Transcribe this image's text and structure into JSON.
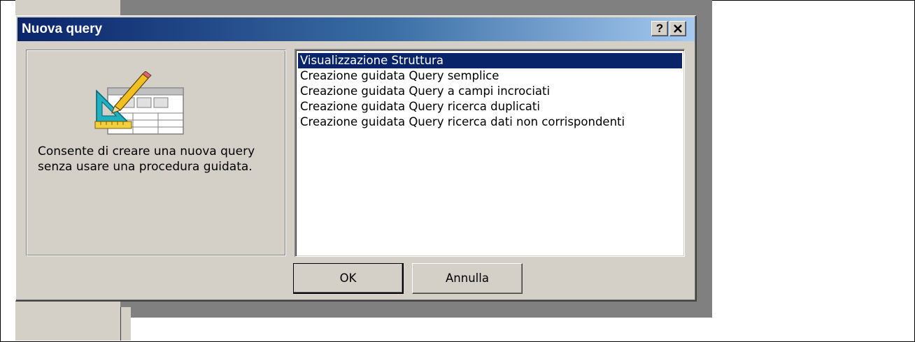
{
  "dialog": {
    "title": "Nuova query",
    "help_label": "?",
    "close_label": "✕"
  },
  "description": {
    "text": "Consente di creare una nuova query senza usare una procedura guidata.",
    "icon": "query-design-icon"
  },
  "options": {
    "items": [
      {
        "label": "Visualizzazione Struttura",
        "selected": true
      },
      {
        "label": "Creazione guidata Query semplice",
        "selected": false
      },
      {
        "label": "Creazione guidata Query a campi incrociati",
        "selected": false
      },
      {
        "label": "Creazione guidata Query ricerca duplicati",
        "selected": false
      },
      {
        "label": "Creazione guidata Query ricerca dati non corrispondenti",
        "selected": false
      }
    ]
  },
  "buttons": {
    "ok_label": "OK",
    "cancel_label": "Annulla"
  },
  "colors": {
    "title_start": "#0a246a",
    "title_end": "#a6caf0",
    "selection": "#0a246a",
    "face": "#d4d0c8"
  }
}
